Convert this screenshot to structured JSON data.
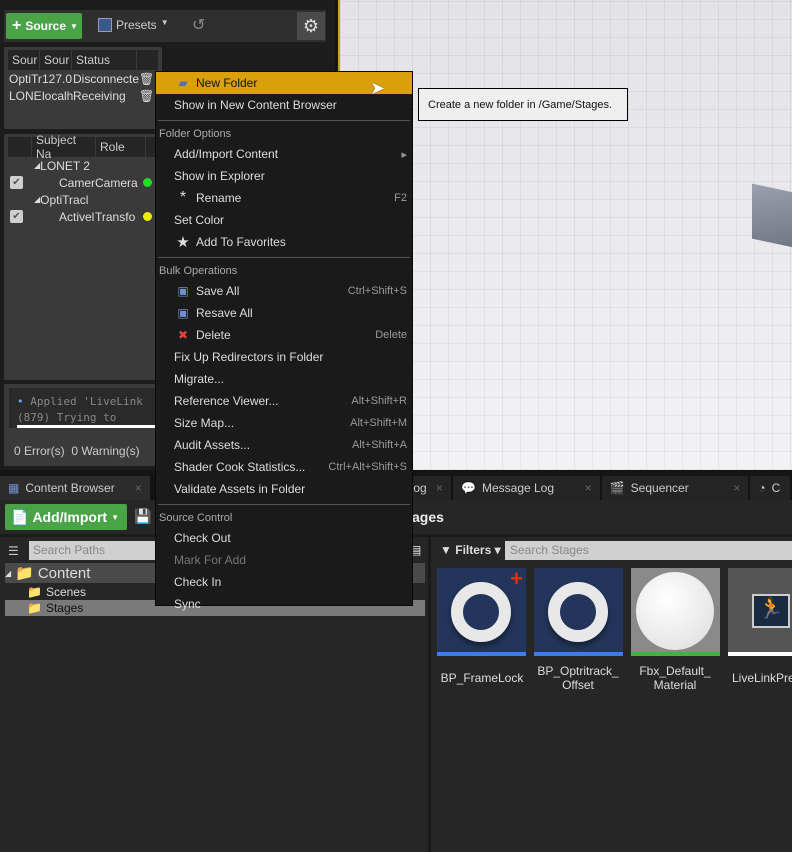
{
  "livelink": {
    "source_button": "Source",
    "presets_button": "Presets",
    "sources_headers": [
      "Sour",
      "Sour",
      "Status"
    ],
    "sources": [
      {
        "name": "OptiTr",
        "addr": "127.0",
        "status": "Disconnecte"
      },
      {
        "name": "LONE",
        "addr": "localh",
        "status": "Receiving"
      }
    ],
    "subjects_headers": [
      "Subject Na",
      "Role"
    ],
    "subjects": [
      {
        "group": "LONET 2",
        "name": "Camer",
        "role": "Camera",
        "status_color": "#22dd22"
      },
      {
        "group": "OptiTracl",
        "name": "Activel",
        "role": "Transfo",
        "status_color": "#eeee00"
      }
    ],
    "log_line1": "Applied 'LiveLink",
    "log_line2": "(879) Trying to ",
    "errors": "0 Error(s)",
    "warnings": "0 Warning(s)"
  },
  "tabs": [
    {
      "label": "Content Browser"
    },
    {
      "label": "Log"
    },
    {
      "label": "Message Log"
    },
    {
      "label": "Sequencer"
    },
    {
      "label": "C"
    }
  ],
  "content_browser": {
    "add_import": "Add/Import",
    "path_title": "Stages",
    "search_paths_placeholder": "Search Paths",
    "filters": "Filters",
    "search_assets_placeholder": "Search Stages",
    "tree": [
      {
        "label": "Content"
      },
      {
        "label": "Scenes"
      },
      {
        "label": "Stages"
      }
    ],
    "assets": [
      {
        "name": "BP_FrameLock",
        "bar": "#3d7cf0"
      },
      {
        "name": "BP_Optritrack_ Offset",
        "bar": "#3d7cf0"
      },
      {
        "name": "Fbx_Default_ Material",
        "bar": "#3cb53c"
      },
      {
        "name": "LiveLinkPre",
        "bar": "#ffffff"
      }
    ]
  },
  "context_menu": {
    "top": [
      {
        "label": "New Folder",
        "icon": "new-folder-icon"
      },
      {
        "label": "Show in New Content Browser"
      }
    ],
    "folder_options_header": "Folder Options",
    "folder_options": [
      {
        "label": "Add/Import Content",
        "submenu": true
      },
      {
        "label": "Show in Explorer"
      },
      {
        "label": "Rename",
        "shortcut": "F2",
        "icon": "rename-icon"
      },
      {
        "label": "Set Color"
      },
      {
        "label": "Add To Favorites",
        "icon": "star-icon"
      }
    ],
    "bulk_header": "Bulk Operations",
    "bulk": [
      {
        "label": "Save All",
        "shortcut": "Ctrl+Shift+S",
        "icon": "save-icon"
      },
      {
        "label": "Resave All",
        "icon": "save-icon"
      },
      {
        "label": "Delete",
        "shortcut": "Delete",
        "icon": "delete-icon"
      },
      {
        "label": "Fix Up Redirectors in Folder"
      },
      {
        "label": "Migrate..."
      },
      {
        "label": "Reference Viewer...",
        "shortcut": "Alt+Shift+R"
      },
      {
        "label": "Size Map...",
        "shortcut": "Alt+Shift+M"
      },
      {
        "label": "Audit Assets...",
        "shortcut": "Alt+Shift+A"
      },
      {
        "label": "Shader Cook Statistics...",
        "shortcut": "Ctrl+Alt+Shift+S"
      },
      {
        "label": "Validate Assets in Folder"
      }
    ],
    "source_control_header": "Source Control",
    "source_control": [
      {
        "label": "Check Out"
      },
      {
        "label": "Mark For Add",
        "disabled": true
      },
      {
        "label": "Check In"
      },
      {
        "label": "Sync"
      }
    ]
  },
  "tooltip": "Create a new folder in /Game/Stages.",
  "colors": {
    "highlight": "#d9a00c",
    "green_button": "#4aa347"
  }
}
